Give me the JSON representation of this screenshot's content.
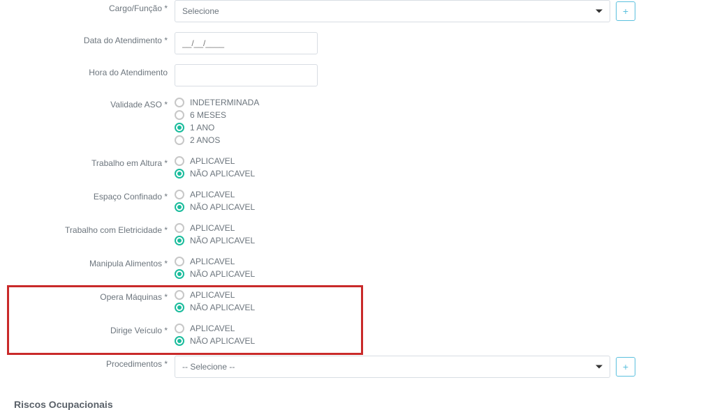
{
  "labels": {
    "cargo": "Cargo/Função *",
    "data_atendimento": "Data do Atendimento *",
    "hora_atendimento": "Hora do Atendimento",
    "validade_aso": "Validade ASO *",
    "trabalho_altura": "Trabalho em Altura *",
    "espaco_confinado": "Espaço Confinado *",
    "trabalho_eletricidade": "Trabalho com Eletricidade *",
    "manipula_alimentos": "Manipula Alimentos *",
    "opera_maquinas": "Opera Máquinas *",
    "dirige_veiculo": "Dirige Veículo *",
    "procedimentos": "Procedimentos *"
  },
  "placeholders": {
    "cargo_select": "Selecione",
    "procedimentos_select": "-- Selecione --",
    "date_mask": "__/__/____"
  },
  "options": {
    "validade_aso": [
      "INDETERMINADA",
      "6 MESES",
      "1 ANO",
      "2 ANOS"
    ],
    "aplicavel": [
      "APLICAVEL",
      "NÃO APLICAVEL"
    ]
  },
  "selected": {
    "validade_aso": "1 ANO",
    "trabalho_altura": "NÃO APLICAVEL",
    "espaco_confinado": "NÃO APLICAVEL",
    "trabalho_eletricidade": "NÃO APLICAVEL",
    "manipula_alimentos": "NÃO APLICAVEL",
    "opera_maquinas": "NÃO APLICAVEL",
    "dirige_veiculo": "NÃO APLICAVEL"
  },
  "section": {
    "riscos": "Riscos Ocupacionais"
  },
  "buttons": {
    "add": "+"
  }
}
